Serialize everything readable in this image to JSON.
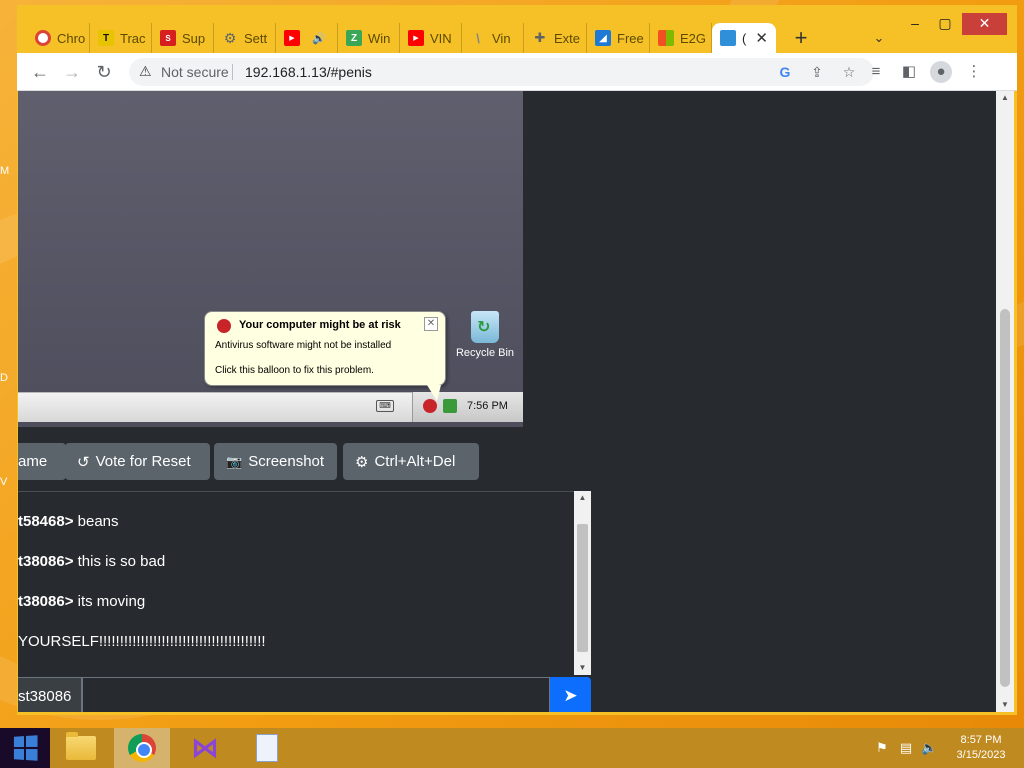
{
  "browser": {
    "tabs": [
      {
        "label": "Chro",
        "icon": "chrome-icon",
        "color": "#db4437"
      },
      {
        "label": "Trac",
        "icon": "tracker-icon",
        "color": "#e8c400"
      },
      {
        "label": "Sup",
        "icon": "sup-icon",
        "color": "#d62020"
      },
      {
        "label": "Sett",
        "icon": "gear-icon",
        "color": "#5f6368"
      },
      {
        "label": "",
        "icon": "youtube-icon",
        "color": "#ff0000"
      },
      {
        "label": "Win",
        "icon": "win-icon",
        "color": "#3aa757"
      },
      {
        "label": "VIN",
        "icon": "youtube-icon",
        "color": "#ff0000"
      },
      {
        "label": "Vin",
        "icon": "vin-icon",
        "color": "#888888"
      },
      {
        "label": "Exte",
        "icon": "puzzle-icon",
        "color": "#5f6368"
      },
      {
        "label": "Free",
        "icon": "free-icon",
        "color": "#1f7ad6"
      },
      {
        "label": "E2G",
        "icon": "ms-icon",
        "color": "#f25022"
      },
      {
        "label": "(",
        "icon": "monitor-icon",
        "color": "#2f8fd8"
      }
    ],
    "new_tab": "+",
    "tab_search": "⌄",
    "url_security": "Not secure",
    "url": "192.168.1.13/#penis"
  },
  "vm": {
    "balloon_title": "Your computer might be at risk",
    "balloon_line1": "Antivirus software might not be installed",
    "balloon_line2": "Click this balloon to fix this problem.",
    "recycle_bin": "Recycle Bin",
    "clock": "7:56 PM"
  },
  "controls": [
    {
      "label": "ame",
      "icon": ""
    },
    {
      "label": "Vote for Reset",
      "icon": "↺"
    },
    {
      "label": "Screenshot",
      "icon": "📷"
    },
    {
      "label": "Ctrl+Alt+Del",
      "icon": "⚙"
    }
  ],
  "chat": {
    "messages": [
      {
        "user": "t58468>",
        "text": " beans"
      },
      {
        "user": "t38086>",
        "text": " this is so bad"
      },
      {
        "user": "t38086>",
        "text": " its moving"
      },
      {
        "user": "",
        "text": "YOURSELF!!!!!!!!!!!!!!!!!!!!!!!!!!!!!!!!!!!!!!!!"
      }
    ],
    "username": "st38086",
    "input_value": "",
    "send_icon": "➤"
  },
  "taskbar": {
    "time": "8:57 PM",
    "date": "3/15/2023"
  },
  "desktop": {
    "edge_letters": [
      "M",
      "D",
      "V"
    ]
  }
}
